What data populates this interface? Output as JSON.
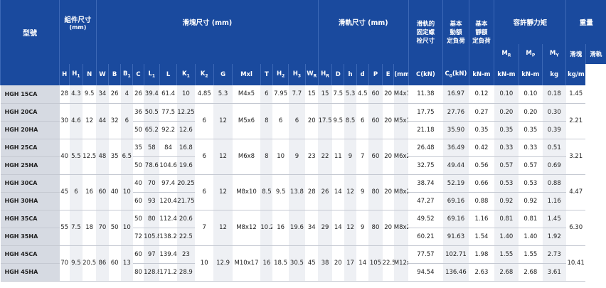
{
  "headers": {
    "model": "型號",
    "assembly": "組件尺寸",
    "assembly_unit": "(mm)",
    "block": "滑塊尺寸 (mm)",
    "rail": "滑軌尺寸 (mm)",
    "bolt1": "滑軌的",
    "bolt2": "固定螺",
    "bolt3": "栓尺寸",
    "dyn1": "基本",
    "dyn2": "動額",
    "dyn3": "定負荷",
    "sta1": "基本",
    "sta2": "靜額",
    "sta3": "定負荷",
    "moment": "容許靜力矩",
    "weight": "重量",
    "w_block": "滑塊",
    "w_rail": "滑軌",
    "m_r": "M",
    "m_r_sub": "R",
    "m_p": "M",
    "m_p_sub": "P",
    "m_y": "M",
    "m_y_sub": "Y",
    "cols": {
      "H": "H",
      "H1": "H",
      "H1s": "1",
      "N": "N",
      "W": "W",
      "B": "B",
      "B1": "B",
      "B1s": "1",
      "C": "C",
      "L1": "L",
      "L1s": "1",
      "L": "L",
      "K1": "K",
      "K1s": "1",
      "K2": "K",
      "K2s": "2",
      "G": "G",
      "Mxl": "Mxl",
      "T": "T",
      "H2": "H",
      "H2s": "2",
      "H3": "H",
      "H3s": "3",
      "WR": "W",
      "WRs": "R",
      "HR": "H",
      "HRs": "R",
      "D": "D",
      "h": "h",
      "d": "d",
      "P": "P",
      "E": "E",
      "bolt_unit": "(mm)",
      "C_unit": "C(kN)",
      "C0_unit": "C",
      "C0s": "0",
      "C0u": "(kN)",
      "moment_unit1": "kN-m",
      "moment_unit2": "kN-m",
      "moment_unit3": "kN-m",
      "kg": "kg",
      "kgm": "kg/m"
    }
  },
  "groups": [
    {
      "rows": [
        {
          "model": "HGH 15CA",
          "C": "26",
          "L1": "39.4",
          "L": "61.4",
          "K1": "10",
          "dyn": "11.38",
          "sta": "16.97",
          "MR": "0.12",
          "MP": "0.10",
          "MY": "0.10",
          "kg": "0.18"
        }
      ],
      "H": "28",
      "H1": "4.3",
      "N": "9.5",
      "W": "34",
      "B": "26",
      "B1": "4",
      "K2": "4.85",
      "G": "5.3",
      "Mxl": "M4x5",
      "T": "6",
      "H2": "7.95",
      "H3": "7.7",
      "WR": "15",
      "HR": "15",
      "D": "7.5",
      "h": "5.3",
      "d": "4.5",
      "P": "60",
      "E": "20",
      "bolt": "M4x16",
      "kgm": "1.45"
    },
    {
      "rows": [
        {
          "model": "HGH 20CA",
          "C": "36",
          "L1": "50.5",
          "L": "77.5",
          "K1": "12.25",
          "dyn": "17.75",
          "sta": "27.76",
          "MR": "0.27",
          "MP": "0.20",
          "MY": "0.20",
          "kg": "0.30"
        },
        {
          "model": "HGH 20HA",
          "C": "50",
          "L1": "65.2",
          "L": "92.2",
          "K1": "12.6",
          "dyn": "21.18",
          "sta": "35.90",
          "MR": "0.35",
          "MP": "0.35",
          "MY": "0.35",
          "kg": "0.39"
        }
      ],
      "H": "30",
      "H1": "4.6",
      "N": "12",
      "W": "44",
      "B": "32",
      "B1": "6",
      "K2": "6",
      "G": "12",
      "Mxl": "M5x6",
      "T": "8",
      "H2": "6",
      "H3": "6",
      "WR": "20",
      "HR": "17.5",
      "D": "9.5",
      "h": "8.5",
      "d": "6",
      "P": "60",
      "E": "20",
      "bolt": "M5x16",
      "kgm": "2.21"
    },
    {
      "rows": [
        {
          "model": "HGH 25CA",
          "C": "35",
          "L1": "58",
          "L": "84",
          "K1": "16.8",
          "dyn": "26.48",
          "sta": "36.49",
          "MR": "0.42",
          "MP": "0.33",
          "MY": "0.33",
          "kg": "0.51"
        },
        {
          "model": "HGH 25HA",
          "C": "50",
          "L1": "78.6",
          "L": "104.6",
          "K1": "19.6",
          "dyn": "32.75",
          "sta": "49.44",
          "MR": "0.56",
          "MP": "0.57",
          "MY": "0.57",
          "kg": "0.69"
        }
      ],
      "H": "40",
      "H1": "5.5",
      "N": "12.5",
      "W": "48",
      "B": "35",
      "B1": "6.5",
      "K2": "6",
      "G": "12",
      "Mxl": "M6x8",
      "T": "8",
      "H2": "10",
      "H3": "9",
      "WR": "23",
      "HR": "22",
      "D": "11",
      "h": "9",
      "d": "7",
      "P": "60",
      "E": "20",
      "bolt": "M6x20",
      "kgm": "3.21"
    },
    {
      "rows": [
        {
          "model": "HGH 30CA",
          "C": "40",
          "L1": "70",
          "L": "97.4",
          "K1": "20.25",
          "dyn": "38.74",
          "sta": "52.19",
          "MR": "0.66",
          "MP": "0.53",
          "MY": "0.53",
          "kg": "0.88"
        },
        {
          "model": "HGH 30HA",
          "C": "60",
          "L1": "93",
          "L": "120.4",
          "K1": "21.75",
          "dyn": "47.27",
          "sta": "69.16",
          "MR": "0.88",
          "MP": "0.92",
          "MY": "0.92",
          "kg": "1.16"
        }
      ],
      "H": "45",
      "H1": "6",
      "N": "16",
      "W": "60",
      "B": "40",
      "B1": "10",
      "K2": "6",
      "G": "12",
      "Mxl": "M8x10",
      "T": "8.5",
      "H2": "9.5",
      "H3": "13.8",
      "WR": "28",
      "HR": "26",
      "D": "14",
      "h": "12",
      "d": "9",
      "P": "80",
      "E": "20",
      "bolt": "M8x25",
      "kgm": "4.47"
    },
    {
      "rows": [
        {
          "model": "HGH 35CA",
          "C": "50",
          "L1": "80",
          "L": "112.4",
          "K1": "20.6",
          "dyn": "49.52",
          "sta": "69.16",
          "MR": "1.16",
          "MP": "0.81",
          "MY": "0.81",
          "kg": "1.45"
        },
        {
          "model": "HGH 35HA",
          "C": "72",
          "L1": "105.8",
          "L": "138.2",
          "K1": "22.5",
          "dyn": "60.21",
          "sta": "91.63",
          "MR": "1.54",
          "MP": "1.40",
          "MY": "1.40",
          "kg": "1.92"
        }
      ],
      "H": "55",
      "H1": "7.5",
      "N": "18",
      "W": "70",
      "B": "50",
      "B1": "10",
      "K2": "7",
      "G": "12",
      "Mxl": "M8x12",
      "T": "10.2",
      "H2": "16",
      "H3": "19.6",
      "WR": "34",
      "HR": "29",
      "D": "14",
      "h": "12",
      "d": "9",
      "P": "80",
      "E": "20",
      "bolt": "M8x25",
      "kgm": "6.30"
    },
    {
      "rows": [
        {
          "model": "HGH 45CA",
          "C": "60",
          "L1": "97",
          "L": "139.4",
          "K1": "23",
          "dyn": "77.57",
          "sta": "102.71",
          "MR": "1.98",
          "MP": "1.55",
          "MY": "1.55",
          "kg": "2.73"
        },
        {
          "model": "HGH 45HA",
          "C": "80",
          "L1": "128.8",
          "L": "171.2",
          "K1": "28.9",
          "dyn": "94.54",
          "sta": "136.46",
          "MR": "2.63",
          "MP": "2.68",
          "MY": "2.68",
          "kg": "3.61"
        }
      ],
      "H": "70",
      "H1": "9.5",
      "N": "20.5",
      "W": "86",
      "B": "60",
      "B1": "13",
      "K2": "10",
      "G": "12.9",
      "Mxl": "M10x17",
      "T": "16",
      "H2": "18.5",
      "H3": "30.5",
      "WR": "45",
      "HR": "38",
      "D": "20",
      "h": "17",
      "d": "14",
      "P": "105",
      "E": "22.5",
      "bolt": "M12x35",
      "kgm": "10.41"
    }
  ]
}
